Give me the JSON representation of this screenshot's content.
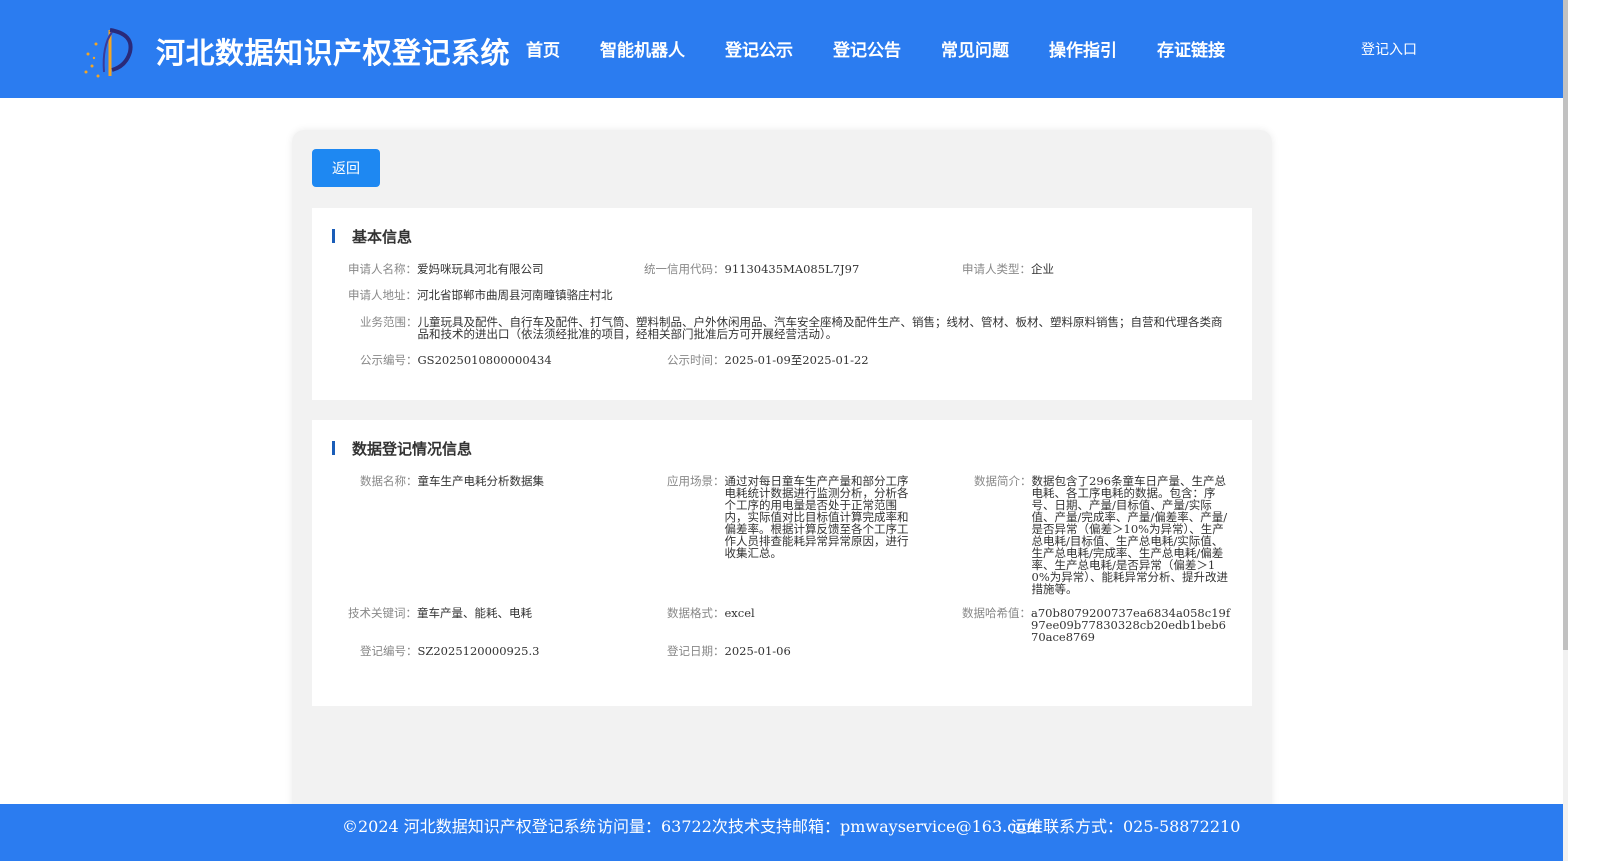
{
  "header": {
    "site_title": "河北数据知识产权登记系统",
    "nav": [
      "首页",
      "智能机器人",
      "登记公示",
      "登记公告",
      "常见问题",
      "操作指引",
      "存证链接"
    ],
    "login": "登记入口"
  },
  "back_label": "返回",
  "basic": {
    "title": "基本信息",
    "applicant_name": {
      "label": "申请人名称：",
      "value": "爱妈咪玩具河北有限公司"
    },
    "credit_code": {
      "label": "统一信用代码：",
      "value": "91130435MA085L7J97"
    },
    "applicant_type": {
      "label": "申请人类型：",
      "value": "企业"
    },
    "address": {
      "label": "申请人地址：",
      "value": "河北省邯郸市曲周县河南疃镇骆庄村北"
    },
    "scope": {
      "label": "业务范围：",
      "value": "儿童玩具及配件、自行车及配件、打气筒、塑料制品、户外休闲用品、汽车安全座椅及配件生产、销售；线材、管材、板材、塑料原料销售；自营和代理各类商品和技术的进出口（依法须经批准的项目，经相关部门批准后方可开展经营活动）。"
    },
    "notice_no": {
      "label": "公示编号：",
      "value": "GS2025010800000434"
    },
    "notice_time": {
      "label": "公示时间：",
      "value": "2025-01-09至2025-01-22"
    }
  },
  "data_reg": {
    "title": "数据登记情况信息",
    "data_name": {
      "label": "数据名称：",
      "value": "童车生产电耗分析数据集"
    },
    "scenario": {
      "label": "应用场景：",
      "value": "通过对每日童车生产产量和部分工序电耗统计数据进行监测分析，分析各个工序的用电量是否处于正常范围内，实际值对比目标值计算完成率和偏差率。根据计算反馈至各个工序工作人员排查能耗异常异常原因，进行收集汇总。"
    },
    "summary": {
      "label": "数据简介：",
      "value": "数据包含了296条童车日产量、生产总电耗、各工序电耗的数据。包含：序号、日期、产量/目标值、产量/实际值、产量/完成率、产量/偏差率、产量/是否异常（偏差＞10%为异常）、生产总电耗/目标值、生产总电耗/实际值、生产总电耗/完成率、生产总电耗/偏差率、生产总电耗/是否异常（偏差＞10%为异常）、能耗异常分析、提升改进措施等。"
    },
    "keywords": {
      "label": "技术关键词：",
      "value": "童车产量、能耗、电耗"
    },
    "format": {
      "label": "数据格式：",
      "value": "excel"
    },
    "hash": {
      "label": "数据哈希值：",
      "value": "a70b8079200737ea6834a058c19f97ee09b77830328cb20edb1beb670ace8769"
    },
    "reg_no": {
      "label": "登记编号：",
      "value": "SZ2025120000925.3"
    },
    "reg_date": {
      "label": "登记日期：",
      "value": "2025-01-06"
    }
  },
  "footer": {
    "copyright": "©2024 河北数据知识产权登记系统",
    "visits": "访问量：63722次",
    "email": "技术支持邮箱：pmwayservice@163.com",
    "phone": "运维联系方式：025-58872210"
  }
}
